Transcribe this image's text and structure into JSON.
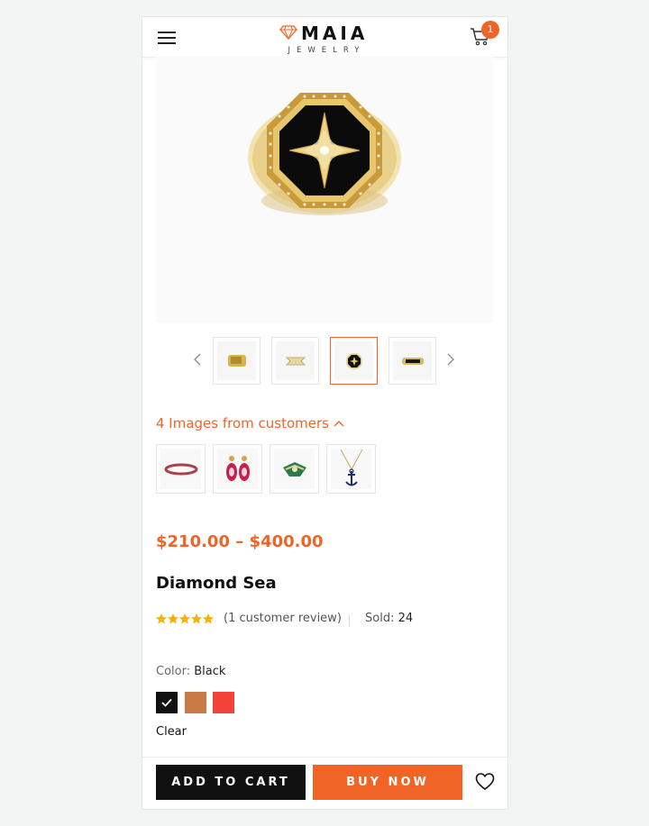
{
  "header": {
    "brand": "MAIA",
    "brand_sub": "JEWELRY",
    "cart_count": "1"
  },
  "gallery": {
    "thumbnails": [
      "ring-thumb-1",
      "ring-thumb-2",
      "ring-thumb-3",
      "ring-thumb-4"
    ],
    "active_index": 2
  },
  "customers": {
    "toggle_label": "4 Images from customers"
  },
  "product": {
    "price": "$210.00 – $400.00",
    "title": "Diamond Sea",
    "rating": 5,
    "review_text": "(1 customer review)",
    "sold_label": "Sold:",
    "sold_value": "24"
  },
  "color": {
    "label": "Color:",
    "selected": "Black",
    "swatches": [
      "#111111",
      "#c97a45",
      "#f2433a"
    ],
    "clear_label": "Clear"
  },
  "actions": {
    "add_to_cart": "ADD TO CART",
    "buy_now": "BUY NOW"
  },
  "colors": {
    "accent": "#f06427",
    "dark": "#111111"
  }
}
